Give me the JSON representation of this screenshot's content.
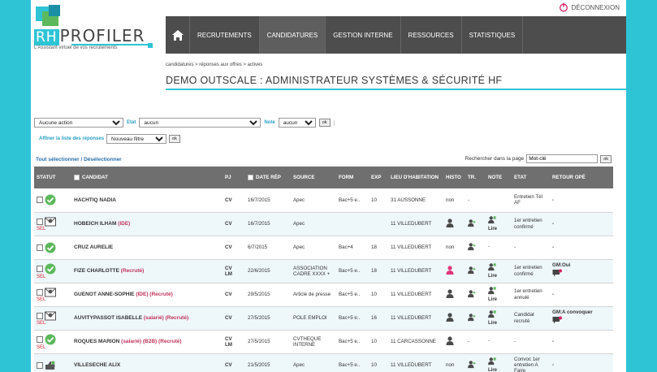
{
  "header": {
    "logo_rh": "RH",
    "logo_profiler": "PROFILER",
    "tagline": "L'Assistant virtuel de vos recrutements",
    "logout": "DÉCONNEXION"
  },
  "nav": {
    "items": [
      "RECRUTEMENTS",
      "CANDIDATURES",
      "GESTION INTERNE",
      "RESSOURCES",
      "STATISTIQUES"
    ]
  },
  "breadcrumb": "candidatures > réponses aux offres > actives",
  "page_title": "DEMO OUTSCALE : ADMINISTRATEUR SYSTÈMES & SÉCURITÉ HF",
  "filters": {
    "action": "Aucune action",
    "etat_label": "Etat",
    "etat_value": "aucun",
    "note_label": "Note",
    "note_value": "aucun",
    "ok": "ok",
    "refine_label": "Affiner la liste des réponses",
    "refine_value": "Nouveau filtre",
    "ok2": "ok"
  },
  "select_all": "Tout sélectionner / Désélectionner",
  "search": {
    "label": "Rechercher dans la page",
    "value": "Mot-clé",
    "ok": "ok"
  },
  "table": {
    "headers": [
      "STATUT",
      "CANDIDAT",
      "PJ",
      "DATE RÉP",
      "SOURCE",
      "FORM",
      "EXP",
      "LIEU D'HABITATION",
      "HISTO",
      "TR.",
      "NOTE",
      "ETAT",
      "RETOUR OPÉ"
    ],
    "rows": [
      {
        "status_icon": "check-circle-icon",
        "sel": "",
        "name": "HACHTIQ NADIA",
        "tags": "",
        "pj": "CV",
        "date": "16/7/2015",
        "source": "Apec",
        "form": "Bac+5 e..",
        "exp": "10",
        "lieu": "31 AUSSONNE",
        "histo": "non",
        "tr": "-",
        "note": "",
        "etat": "Entretien Tél AF",
        "retour": "-"
      },
      {
        "status_icon": "mail-icon",
        "sel": "SEL",
        "name": "HOBEICH ILHAM",
        "tags": "(IDE)",
        "pj": "CV",
        "date": "16/7/2015",
        "source": "Apec",
        "form": "",
        "exp": "",
        "lieu": "11 VILLEDUBERT",
        "histo": "person",
        "tr": "person",
        "note": "Lire",
        "etat": "1er entretien confirmé",
        "retour": "-"
      },
      {
        "status_icon": "check-circle-icon",
        "sel": "",
        "name": "CRUZ AURELIE",
        "tags": "",
        "pj": "CV",
        "date": "6/7/2015",
        "source": "Apec",
        "form": "Bac+4",
        "exp": "18",
        "lieu": "11 VILLEDUBERT",
        "histo": "non",
        "tr": "person",
        "note": "-",
        "etat": "-",
        "retour": "-"
      },
      {
        "status_icon": "check-circle-icon",
        "sel": "SEL",
        "name": "FIZE CHARLOTTE",
        "tags": "(Recruté)",
        "pj": "CV LM",
        "date": "22/6/2015",
        "source": "ASSOCIATION CADRE XXXX +",
        "form": "Bac+5 e..",
        "exp": "18",
        "lieu": "11 VILLEDUBERT",
        "histo": "person-pink",
        "tr": "person",
        "note": "Lire",
        "etat": "1er entretien confirmé",
        "retour": "GM:Oui"
      },
      {
        "status_icon": "mail-icon",
        "sel": "SEL",
        "name": "GUENOT ANNE-SOPHIE",
        "tags": "(IDE) (Recruté)",
        "pj": "CV",
        "date": "29/5/2015",
        "source": "Article de presse",
        "form": "Bac+5 e..",
        "exp": "10",
        "lieu": "11 VILLEDUBERT",
        "histo": "person",
        "tr": "person",
        "note": "Lire",
        "etat": "1er entretien annulé",
        "retour": "-"
      },
      {
        "status_icon": "mail-icon",
        "sel": "SEL",
        "name": "AUVITYPASSOT ISABELLE",
        "tags": "(salarié) (Recruté)",
        "pj": "CV",
        "date": "27/5/2015",
        "source": "POLE EMPLOI",
        "form": "Bac+5 e..",
        "exp": "16",
        "lieu": "11 VILLEDUBERT",
        "histo": "person",
        "tr": "person",
        "note": "Lire",
        "etat": "Candidat recruté",
        "retour": "GM:A convoquer"
      },
      {
        "status_icon": "check-circle-icon",
        "sel": "SEL",
        "name": "ROQUES MARION",
        "tags": "(salarié) (B2B) (Recruté)",
        "pj": "CV LM",
        "date": "27/5/2015",
        "source": "CVTHEQUE INTERNE",
        "form": "Bac+5 e..",
        "exp": "10",
        "lieu": "11 CARCASSONNE",
        "histo": "person",
        "tr": "-",
        "note": "-",
        "etat": "-",
        "retour": "-"
      },
      {
        "status_icon": "thumb-icon",
        "sel": "",
        "name": "VILLESECHE ALIX",
        "tags": "",
        "pj": "CV",
        "date": "21/5/2015",
        "source": "Apec",
        "form": "Bac+5 e..",
        "exp": "10",
        "lieu": "11 VILLEDUBERT",
        "histo": "non",
        "tr": "person",
        "note": "Lire",
        "etat": "Convoc 1er entretien A Faire",
        "retour": "-"
      }
    ]
  },
  "colors": {
    "accent": "#2ec4d6",
    "nav": "#4d4d4d",
    "check": "#5cb85c",
    "tag": "#c0335a"
  }
}
